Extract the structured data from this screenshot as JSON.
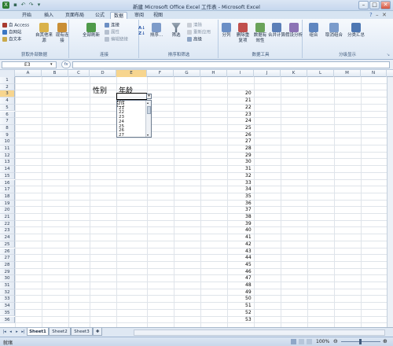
{
  "window": {
    "title": "新建 Microsoft Office Excel 工作表 - Microsoft Excel"
  },
  "menu_tabs": [
    {
      "label": "开始",
      "active": false
    },
    {
      "label": "插入",
      "active": false
    },
    {
      "label": "页面布局",
      "active": false
    },
    {
      "label": "公式",
      "active": false
    },
    {
      "label": "数据",
      "active": true
    },
    {
      "label": "审阅",
      "active": false
    },
    {
      "label": "视图",
      "active": false
    }
  ],
  "ribbon": {
    "groups": {
      "external": "获取外部数据",
      "connections": "连接",
      "sort_filter": "排序和筛选",
      "data_tools": "数据工具",
      "outline": "分级显示"
    },
    "buttons": {
      "from_access": "自 Access",
      "from_web": "自网站",
      "from_text": "自文本",
      "from_other": "自其他来源",
      "existing": "现有连接",
      "refresh_all": "全部刷新",
      "connections": "连接",
      "properties": "属性",
      "edit_links": "编辑链接",
      "sort": "排序...",
      "filter": "筛选",
      "clear": "清除",
      "reapply": "重新应用",
      "advanced": "高级",
      "text_to_columns": "分列",
      "remove_dup": "删除重复项",
      "validation": "数据有效性",
      "consolidate": "合并计算",
      "whatif": "假设分析",
      "group": "组合",
      "ungroup": "取消组合",
      "subtotal": "分类汇总"
    }
  },
  "formula_bar": {
    "name_box": "E3",
    "fx": "fx",
    "value": ""
  },
  "columns": [
    "A",
    "B",
    "C",
    "D",
    "E",
    "F",
    "G",
    "H",
    "I",
    "J",
    "K",
    "L",
    "M",
    "N"
  ],
  "selected_column": "E",
  "selected_row": 3,
  "rows": [
    1,
    2,
    3,
    4,
    5,
    6,
    7,
    8,
    9,
    10,
    11,
    12,
    13,
    14,
    15,
    16,
    17,
    18,
    19,
    20,
    21,
    22,
    23,
    24,
    25,
    26,
    27,
    28,
    29,
    30,
    31,
    32,
    33,
    34,
    35,
    36
  ],
  "cells": {
    "D2": "性别",
    "E2": "年龄"
  },
  "column_i_values": [
    "20",
    "21",
    "22",
    "23",
    "24",
    "25",
    "26",
    "27",
    "28",
    "29",
    "30",
    "31",
    "32",
    "33",
    "34",
    "35",
    "36",
    "37",
    "38",
    "39",
    "40",
    "41",
    "42",
    "43",
    "44",
    "45",
    "46",
    "47",
    "48",
    "49",
    "50",
    "51",
    "52",
    "53"
  ],
  "dropdown_options": [
    "20",
    "21",
    "22",
    "23",
    "24",
    "25",
    "26",
    "27"
  ],
  "dropdown_highlighted_index": 0,
  "sheet_tabs": [
    {
      "label": "Sheet1",
      "active": true
    },
    {
      "label": "Sheet2",
      "active": false
    },
    {
      "label": "Sheet3",
      "active": false
    }
  ],
  "status": {
    "mode": "就绪",
    "zoom": "100%"
  }
}
